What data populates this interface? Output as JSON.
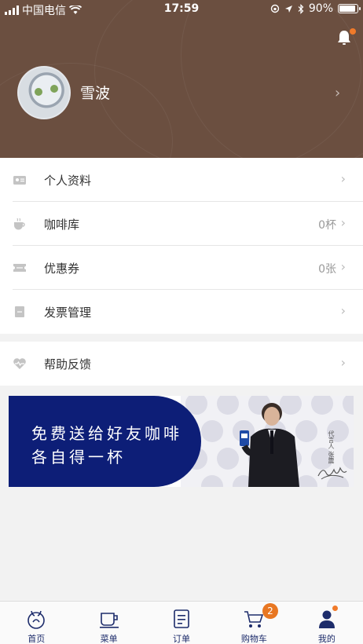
{
  "status_bar": {
    "carrier": "中国电信",
    "time": "17:59",
    "battery_percent": "90%",
    "battery_level": 0.9
  },
  "profile": {
    "name": "雪波"
  },
  "menu": {
    "items": [
      {
        "label": "个人资料",
        "value": "",
        "icon": "id-card-icon"
      },
      {
        "label": "咖啡库",
        "value": "0杯",
        "icon": "coffee-cup-icon"
      },
      {
        "label": "优惠券",
        "value": "0张",
        "icon": "coupon-icon"
      },
      {
        "label": "发票管理",
        "value": "",
        "icon": "invoice-icon"
      }
    ],
    "help": {
      "label": "帮助反馈",
      "icon": "heart-pulse-icon"
    }
  },
  "banner": {
    "line1": "免费送给好友咖啡",
    "line2": "各自得一杯",
    "spokesperson": "代言人 张震"
  },
  "tabbar": {
    "tabs": [
      {
        "label": "首页",
        "icon": "deer-home-icon"
      },
      {
        "label": "菜单",
        "icon": "cup-menu-icon"
      },
      {
        "label": "订单",
        "icon": "order-list-icon"
      },
      {
        "label": "购物车",
        "icon": "cart-icon"
      },
      {
        "label": "我的",
        "icon": "user-icon"
      }
    ],
    "cart_badge": "2"
  },
  "colors": {
    "header_bg": "#6b4f40",
    "banner_blue": "#0d1e77",
    "accent_orange": "#e87722",
    "tab_text": "#1d2c6b"
  }
}
